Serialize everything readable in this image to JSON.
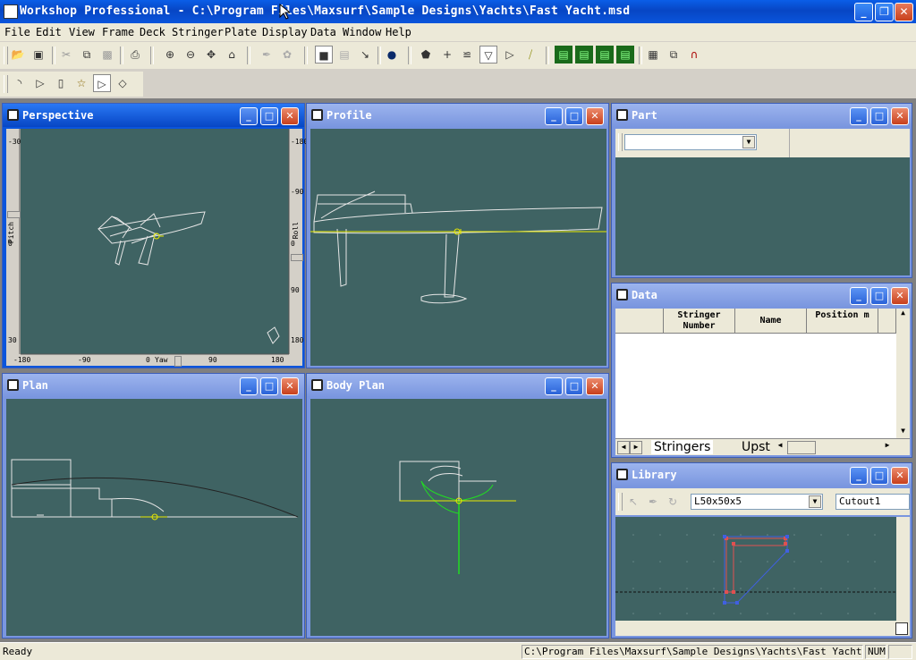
{
  "window": {
    "title": "Workshop Professional - C:\\Program Files\\Maxsurf\\Sample Designs\\Yachts\\Fast Yacht.msd",
    "minimize": "_",
    "restore": "❐",
    "close": "✕"
  },
  "menu": [
    "File",
    "Edit",
    "View",
    "Frame",
    "Deck",
    "Stringer",
    "Plate",
    "Display",
    "Data",
    "Window",
    "Help"
  ],
  "toolbar_row1_icons": [
    "open-icon",
    "save-icon",
    "cut-icon",
    "copy-icon",
    "paste-icon",
    "print-icon",
    "zoom-in-icon",
    "zoom-out-icon",
    "pan-icon",
    "home-icon",
    "edit-tool-icon",
    "shape-tool-icon",
    "select-part-icon",
    "select-group-icon",
    "pointer-icon",
    "render-icon",
    "plate-icon",
    "add-point-icon",
    "stringers-icon",
    "frame-icon",
    "deck-icon",
    "angle-icon",
    "grid-icon",
    "panel-icon",
    "stack-icon",
    "table-icon",
    "select-icon",
    "profile-icon"
  ],
  "toolbar_row2_icons": [
    "hull-icon",
    "bow-icon",
    "stern-icon",
    "wand-icon",
    "section-icon",
    "diamond-icon"
  ],
  "panes": {
    "perspective": {
      "title": "Perspective",
      "pitch_label": "Pitch",
      "roll_label": "Roll",
      "yaw_label": "Yaw",
      "left_ticks": [
        "-30",
        "0",
        "30"
      ],
      "right_ticks": [
        "-180",
        "-90",
        "0",
        "90",
        "180"
      ],
      "bottom_ticks": [
        "-180",
        "-90",
        "0",
        "90",
        "180"
      ]
    },
    "profile": {
      "title": "Profile"
    },
    "plan": {
      "title": "Plan"
    },
    "body_plan": {
      "title": "Body Plan"
    },
    "part": {
      "title": "Part",
      "dropdown_value": ""
    },
    "data": {
      "title": "Data",
      "columns": [
        "Stringer Number",
        "Name",
        "Position m"
      ],
      "tabs": [
        "Stringers",
        "Upst"
      ]
    },
    "library": {
      "title": "Library",
      "section_value": "L50x50x5",
      "cutout_value": "Cutout1"
    }
  },
  "status": {
    "ready": "Ready",
    "path": "C:\\Program Files\\Maxsurf\\Sample Designs\\Yachts\\Fast Yacht.msd",
    "num": "NUM"
  },
  "colors": {
    "viewport_bg": "#3f6363",
    "active_title": "#0a55dc",
    "inactive_title": "#7a96df",
    "waterline": "#e8e800",
    "section_green": "#22dd22"
  }
}
